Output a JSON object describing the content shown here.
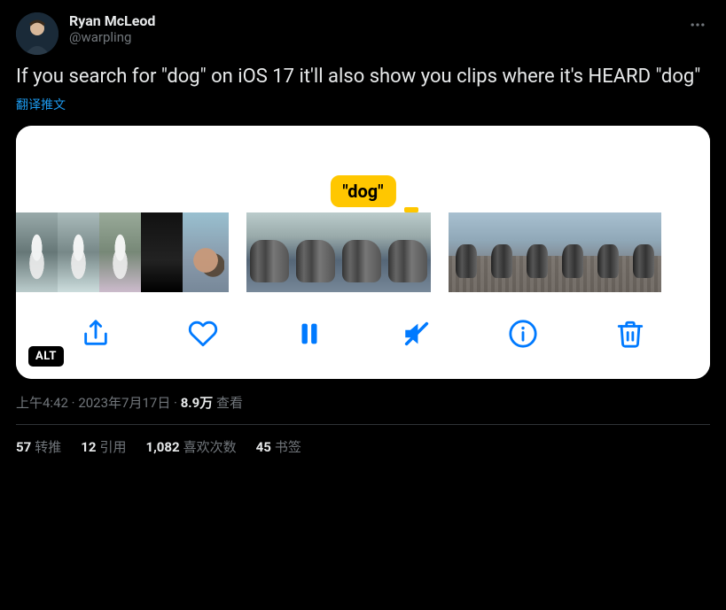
{
  "author": {
    "display_name": "Ryan McLeod",
    "handle": "@warpling"
  },
  "tweet_text": "If you search for \"dog\" on iOS 17 it'll also show you clips where it's HEARD \"dog\"",
  "translate_label": "翻译推文",
  "media": {
    "caption_bubble": "\"dog\"",
    "alt_badge": "ALT"
  },
  "meta": {
    "time": "上午4:42",
    "date": "2023年7月17日",
    "views_count": "8.9万",
    "views_label": " 查看",
    "separator": " · "
  },
  "stats": {
    "retweets": {
      "count": "57",
      "label": "转推"
    },
    "quotes": {
      "count": "12",
      "label": "引用"
    },
    "likes": {
      "count": "1,082",
      "label": "喜欢次数"
    },
    "bookmarks": {
      "count": "45",
      "label": "书签"
    }
  }
}
